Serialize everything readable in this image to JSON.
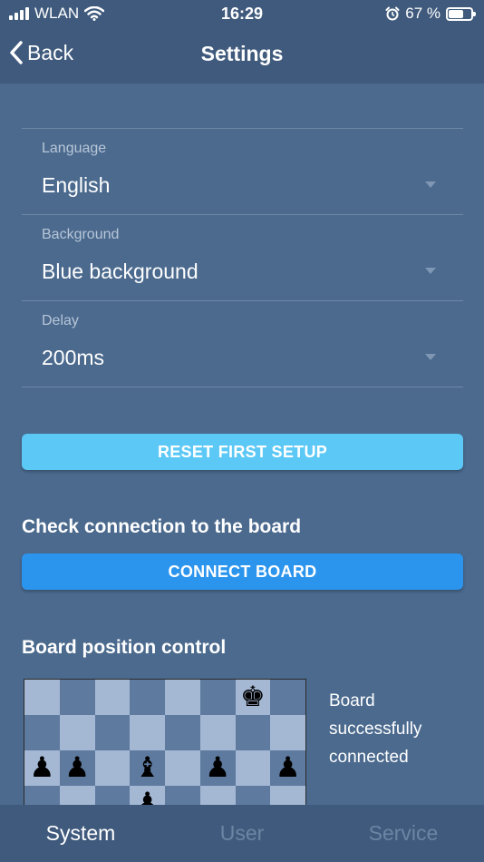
{
  "status_bar": {
    "carrier": "WLAN",
    "time": "16:29",
    "battery_percent": "67 %",
    "battery_level": 0.67
  },
  "nav": {
    "back_label": "Back",
    "title": "Settings"
  },
  "settings": {
    "language": {
      "label": "Language",
      "value": "English"
    },
    "background": {
      "label": "Background",
      "value": "Blue background"
    },
    "delay": {
      "label": "Delay",
      "value": "200ms"
    }
  },
  "buttons": {
    "reset_label": "RESET FIRST SETUP",
    "connect_label": "CONNECT BOARD"
  },
  "sections": {
    "check_connection": "Check connection to the board",
    "board_position": "Board position control"
  },
  "board": {
    "pieces": [
      {
        "row": 0,
        "col": 6,
        "glyph": "♚",
        "name": "black-king-icon"
      },
      {
        "row": 2,
        "col": 0,
        "glyph": "♟",
        "name": "black-pawn-icon"
      },
      {
        "row": 2,
        "col": 1,
        "glyph": "♟",
        "name": "black-pawn-icon"
      },
      {
        "row": 2,
        "col": 3,
        "glyph": "♝",
        "name": "black-bishop-icon"
      },
      {
        "row": 2,
        "col": 5,
        "glyph": "♟",
        "name": "black-pawn-icon"
      },
      {
        "row": 2,
        "col": 7,
        "glyph": "♟",
        "name": "black-pawn-icon"
      },
      {
        "row": 3,
        "col": 3,
        "glyph": "♟",
        "name": "black-pawn-icon"
      }
    ],
    "status_text": "Board successfully connected"
  },
  "tabs": [
    {
      "label": "System",
      "active": true
    },
    {
      "label": "User",
      "active": false
    },
    {
      "label": "Service",
      "active": false
    }
  ],
  "colors": {
    "background": "#4b6a8e",
    "bar": "#3f5a7c",
    "reset_button": "#5bc8f6",
    "connect_button": "#2b95ee"
  }
}
